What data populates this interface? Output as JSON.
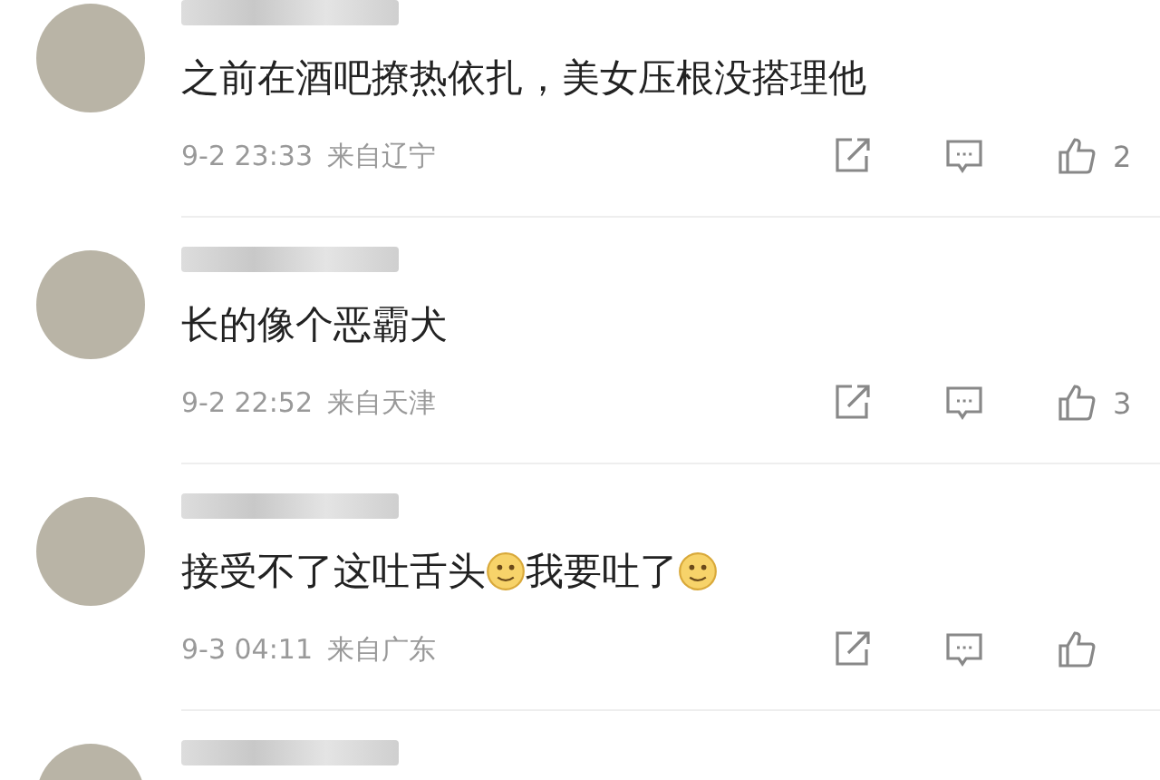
{
  "comments": [
    {
      "kind": "full",
      "content": [
        {
          "kind": "text",
          "text": "之前在酒吧撩热依扎，美女压根没搭理他"
        }
      ],
      "time": "9-2 23:33",
      "location": "来自辽宁",
      "likes": "2"
    },
    {
      "kind": "full",
      "content": [
        {
          "kind": "text",
          "text": "长的像个恶霸犬"
        }
      ],
      "time": "9-2 22:52",
      "location": "来自天津",
      "likes": "3"
    },
    {
      "kind": "full",
      "content": [
        {
          "kind": "text",
          "text": "接受不了这吐舌头"
        },
        {
          "kind": "emoji"
        },
        {
          "kind": "text",
          "text": "我要吐了"
        },
        {
          "kind": "emoji"
        }
      ],
      "time": "9-3 04:11",
      "location": "来自广东"
    },
    {
      "kind": "partial"
    }
  ]
}
